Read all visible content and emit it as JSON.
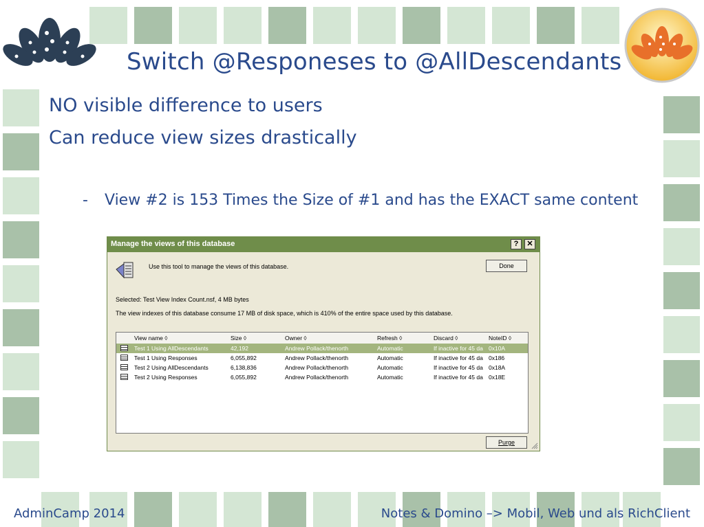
{
  "slide": {
    "title": "Switch @Responeses to @AllDescendants",
    "bullets": [
      "NO visible difference to users",
      "Can reduce view sizes drastically"
    ],
    "subbullet_dash": "-",
    "subbullet": "View #2 is 153 Times the Size of #1 and has the EXACT same content",
    "footer_left": "AdminCamp 2014",
    "footer_right": "Notes & Domino –> Mobil, Web und als RichClient"
  },
  "dialog": {
    "title": "Manage the views of this database",
    "help_label": "?",
    "close_label": "✕",
    "intro": "Use this tool to manage the views of this database.",
    "selected": "Selected:   Test View Index Count.nsf, 4 MB bytes",
    "summary": "The view indexes of this database consume 17 MB of disk space, which is 410% of the entire space used by this database.",
    "done_label": "Done",
    "purge_label": "Purge",
    "columns": [
      "View name ◊",
      "Size ◊",
      "Owner ◊",
      "Refresh ◊",
      "Discard ◊",
      "NoteID ◊"
    ],
    "rows": [
      {
        "name": "Test 1 Using AllDescendants",
        "size": "42,192",
        "owner": "Andrew Pollack/thenorth",
        "refresh": "Automatic",
        "discard": "If inactive for 45 da",
        "noteid": "0x10A"
      },
      {
        "name": "Test 1 Using Responses",
        "size": "6,055,892",
        "owner": "Andrew Pollack/thenorth",
        "refresh": "Automatic",
        "discard": "If inactive for 45 da",
        "noteid": "0x186"
      },
      {
        "name": "Test 2 Using AllDescendants",
        "size": "6,138,836",
        "owner": "Andrew Pollack/thenorth",
        "refresh": "Automatic",
        "discard": "If inactive for 45 da",
        "noteid": "0x18A"
      },
      {
        "name": "Test 2 Using Responses",
        "size": "6,055,892",
        "owner": "Andrew Pollack/thenorth",
        "refresh": "Automatic",
        "discard": "If inactive for 45 da",
        "noteid": "0x18E"
      }
    ]
  },
  "colors": {
    "accent": "#2a4a8c",
    "tile_light": "#d4e6d4",
    "tile_dark": "#a9c1a9",
    "titlebar": "#6f8d4a"
  }
}
